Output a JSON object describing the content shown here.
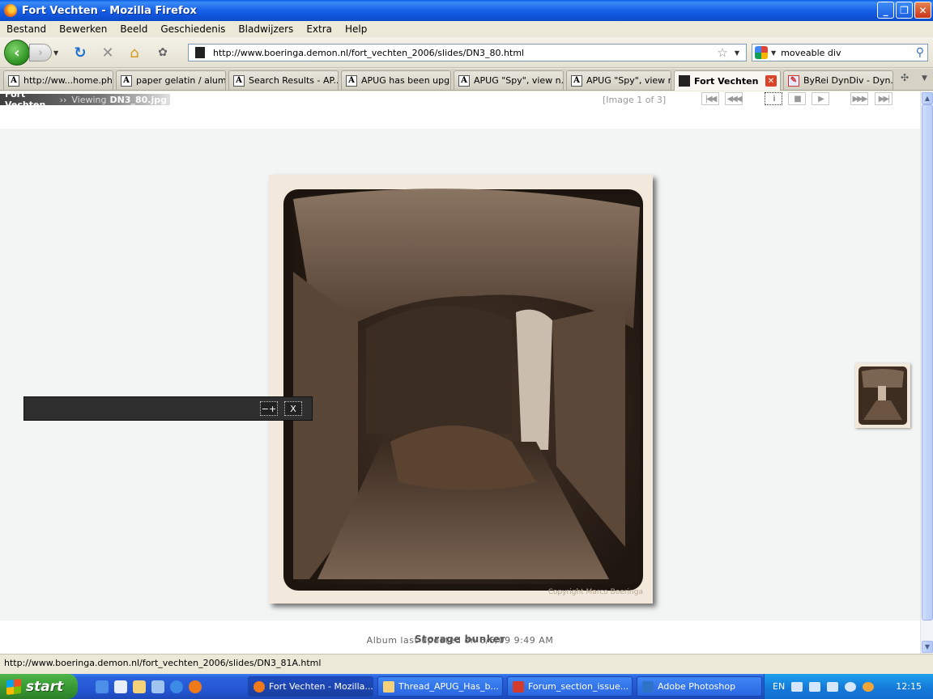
{
  "window": {
    "title": "Fort Vechten - Mozilla Firefox"
  },
  "menu": [
    "Bestand",
    "Bewerken",
    "Beeld",
    "Geschiedenis",
    "Bladwijzers",
    "Extra",
    "Help"
  ],
  "nav": {
    "url": "http://www.boeringa.demon.nl/fort_vechten_2006/slides/DN3_80.html",
    "search_value": "moveable div"
  },
  "tabs": [
    {
      "label": "http://ww...home.php",
      "icon": "A"
    },
    {
      "label": "paper gelatin / alum...",
      "icon": "A"
    },
    {
      "label": "Search Results - AP...",
      "icon": "A"
    },
    {
      "label": "APUG has been upg...",
      "icon": "A"
    },
    {
      "label": "APUG \"Spy\", view n...",
      "icon": "A"
    },
    {
      "label": "APUG \"Spy\", view n...",
      "icon": "A"
    },
    {
      "label": "Fort Vechten",
      "icon": ""
    },
    {
      "label": "ByRei DynDiv - Dyn...",
      "icon": ""
    }
  ],
  "page": {
    "breadcrumb_site": "Fort Vechten",
    "breadcrumb_sep": "››",
    "breadcrumb_viewing": "Viewing",
    "breadcrumb_file": "DN3_80.jpg",
    "image_counter": "[Image 1 of 3]",
    "watermark": "Copyright Marco Boeringa",
    "caption": "Storage bunker",
    "updated": "Album last updated on 8/6/09 9:49 AM",
    "controls": {
      "first": "|◀◀",
      "prev": "◀◀◀",
      "info": "i",
      "stop": "■",
      "play": "▶",
      "next": "▶▶▶",
      "last": "▶▶|"
    },
    "dyndiv": {
      "toggle": "−+",
      "close": "X"
    }
  },
  "status": {
    "text": "http://www.boeringa.demon.nl/fort_vechten_2006/slides/DN3_81A.html"
  },
  "taskbar": {
    "start": "start",
    "tasks": [
      {
        "label": "Fort Vechten - Mozilla...",
        "color": "#f07a1a"
      },
      {
        "label": "Thread_APUG_Has_b...",
        "color": "#f3d27a"
      },
      {
        "label": "Forum_section_issue...",
        "color": "#d33b2c"
      },
      {
        "label": "Adobe Photoshop",
        "color": "#2e73c8"
      }
    ],
    "lang": "EN",
    "clock": "12:15"
  },
  "colors": {
    "sepia_dark": "#2e2118",
    "sepia_mid": "#6a5240",
    "sepia_light": "#c9b7a2",
    "paper": "#f2e8dc"
  }
}
